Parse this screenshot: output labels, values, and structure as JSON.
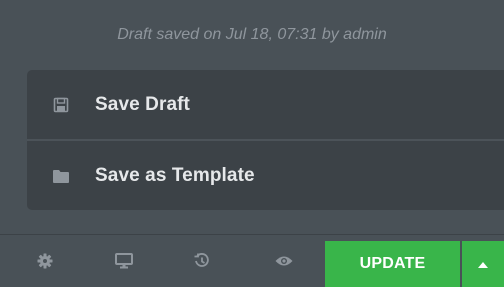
{
  "status": {
    "draft_saved_text": "Draft saved on Jul 18, 07:31 by admin"
  },
  "save_menu": {
    "items": [
      {
        "label": "Save Draft",
        "icon": "floppy-disk-icon"
      },
      {
        "label": "Save as Template",
        "icon": "folder-icon"
      }
    ]
  },
  "footer": {
    "icons": [
      "gear-icon",
      "desktop-monitor-icon",
      "history-icon",
      "eye-icon"
    ],
    "update_label": "UPDATE",
    "update_caret_icon": "caret-up-icon"
  },
  "colors": {
    "panel_background": "#495157",
    "menu_background": "#3c4247",
    "accent_green": "#39b54a"
  }
}
